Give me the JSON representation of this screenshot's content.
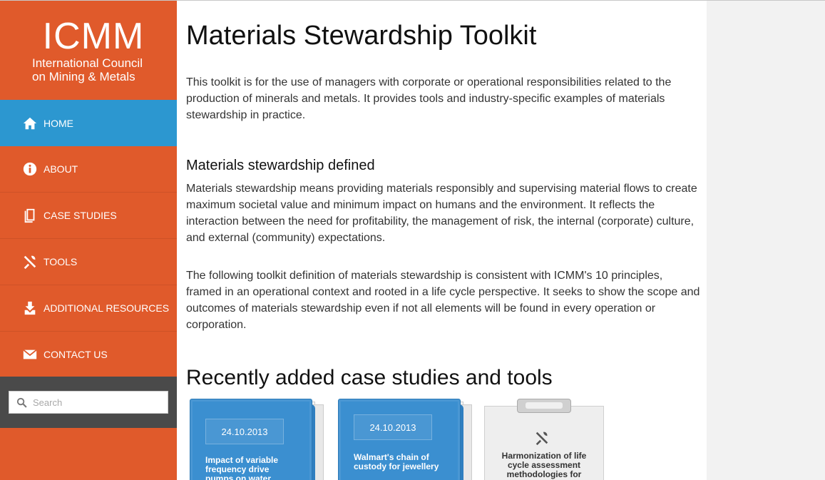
{
  "logo": {
    "abbr": "ICMM",
    "line1": "International Council",
    "line2": "on Mining & Metals"
  },
  "nav": [
    {
      "label": "HOME",
      "icon": "home-icon",
      "active": true
    },
    {
      "label": "ABOUT",
      "icon": "info-icon"
    },
    {
      "label": "CASE STUDIES",
      "icon": "documents-icon"
    },
    {
      "label": "TOOLS",
      "icon": "tools-icon"
    },
    {
      "label": "ADDITIONAL RESOURCES",
      "icon": "download-icon"
    },
    {
      "label": "CONTACT US",
      "icon": "envelope-icon"
    }
  ],
  "search": {
    "placeholder": "Search"
  },
  "colors": {
    "sidebar": "#e05a2b",
    "active_nav": "#2c97d0",
    "search_bar": "#4a4a4a",
    "card_blue": "#3b8fd0"
  },
  "main": {
    "title": "Materials Stewardship Toolkit",
    "intro": "This toolkit is for the use of managers with corporate or operational responsibilities related to the production of minerals and metals. It provides tools and industry-specific examples of materials stewardship in practice.",
    "section_heading": "Materials stewardship defined",
    "para1": "Materials stewardship means providing materials responsibly and supervising material flows to create maximum societal value and minimum impact on humans and the environment.  It reflects the interaction between the need for profitability, the management of risk, the internal (corporate) culture, and external (community) expectations.",
    "para2": "The following toolkit definition of materials stewardship is consistent with ICMM's 10 principles, framed in an operational context and rooted in a life cycle perspective. It seeks to show the scope and outcomes of materials stewardship even if not all elements will be found in every operation or corporation.",
    "recent_heading": "Recently added case studies and tools"
  },
  "cards": [
    {
      "type": "case-study",
      "date": "24.10.2013",
      "title": "Impact of variable frequency drive pumps on water"
    },
    {
      "type": "case-study",
      "date": "24.10.2013",
      "title": "Walmart's chain of custody for jewellery"
    },
    {
      "type": "tool",
      "title": "Harmonization of life cycle assessment methodologies for"
    }
  ]
}
